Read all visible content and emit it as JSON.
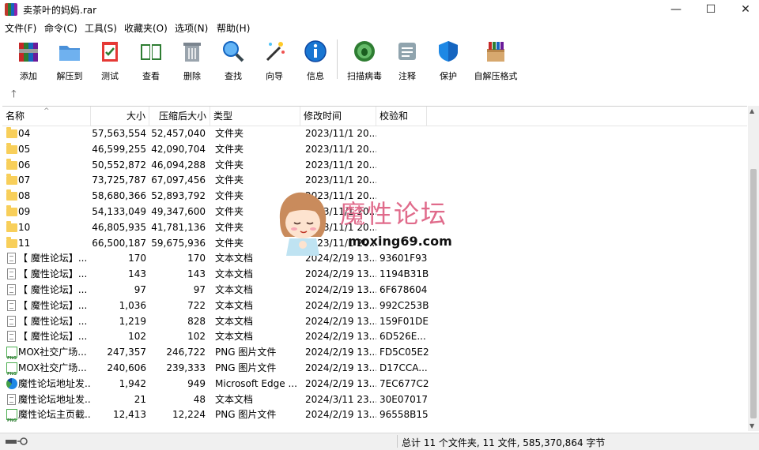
{
  "window": {
    "title": "卖茶叶的妈妈.rar",
    "controls": [
      "—",
      "☐",
      "✕"
    ]
  },
  "menu": [
    "文件(F)",
    "命令(C)",
    "工具(S)",
    "收藏夹(O)",
    "选项(N)",
    "帮助(H)"
  ],
  "toolbar": [
    {
      "label": "添加",
      "icon": "archive-books-icon"
    },
    {
      "label": "解压到",
      "icon": "folder-extract-icon"
    },
    {
      "label": "测试",
      "icon": "clipboard-check-icon"
    },
    {
      "label": "查看",
      "icon": "open-book-icon"
    },
    {
      "label": "删除",
      "icon": "trash-can-icon"
    },
    {
      "label": "查找",
      "icon": "magnifier-icon"
    },
    {
      "label": "向导",
      "icon": "magic-wand-icon"
    },
    {
      "label": "信息",
      "icon": "info-icon"
    },
    {
      "label": "扫描病毒",
      "icon": "bug-scan-icon"
    },
    {
      "label": "注释",
      "icon": "comment-icon"
    },
    {
      "label": "保护",
      "icon": "shield-icon"
    },
    {
      "label": "自解压格式",
      "icon": "sfx-box-icon"
    }
  ],
  "columns": [
    "名称",
    "大小",
    "压缩后大小",
    "类型",
    "修改时间",
    "校验和"
  ],
  "rows": [
    {
      "kind": "folder",
      "name": "04",
      "size": "57,563,554",
      "packed": "52,457,040",
      "type": "文件夹",
      "modified": "2023/11/1 20...",
      "crc": ""
    },
    {
      "kind": "folder",
      "name": "05",
      "size": "46,599,255",
      "packed": "42,090,704",
      "type": "文件夹",
      "modified": "2023/11/1 20...",
      "crc": ""
    },
    {
      "kind": "folder",
      "name": "06",
      "size": "50,552,872",
      "packed": "46,094,288",
      "type": "文件夹",
      "modified": "2023/11/1 20...",
      "crc": ""
    },
    {
      "kind": "folder",
      "name": "07",
      "size": "73,725,787",
      "packed": "67,097,456",
      "type": "文件夹",
      "modified": "2023/11/1 20...",
      "crc": ""
    },
    {
      "kind": "folder",
      "name": "08",
      "size": "58,680,366",
      "packed": "52,893,792",
      "type": "文件夹",
      "modified": "2023/11/1 20...",
      "crc": ""
    },
    {
      "kind": "folder",
      "name": "09",
      "size": "54,133,049",
      "packed": "49,347,600",
      "type": "文件夹",
      "modified": "2023/11/1 20...",
      "crc": ""
    },
    {
      "kind": "folder",
      "name": "10",
      "size": "46,805,935",
      "packed": "41,781,136",
      "type": "文件夹",
      "modified": "2023/11/1 20...",
      "crc": ""
    },
    {
      "kind": "folder",
      "name": "11",
      "size": "66,500,187",
      "packed": "59,675,936",
      "type": "文件夹",
      "modified": "2023/11/1 20...",
      "crc": ""
    },
    {
      "kind": "text",
      "name": "【 魔性论坛】...",
      "size": "170",
      "packed": "170",
      "type": "文本文档",
      "modified": "2024/2/19 13...",
      "crc": "93601F93"
    },
    {
      "kind": "text",
      "name": "【 魔性论坛】...",
      "size": "143",
      "packed": "143",
      "type": "文本文档",
      "modified": "2024/2/19 13...",
      "crc": "1194B31B"
    },
    {
      "kind": "text",
      "name": "【 魔性论坛】...",
      "size": "97",
      "packed": "97",
      "type": "文本文档",
      "modified": "2024/2/19 13...",
      "crc": "6F678604"
    },
    {
      "kind": "text",
      "name": "【 魔性论坛】...",
      "size": "1,036",
      "packed": "722",
      "type": "文本文档",
      "modified": "2024/2/19 13...",
      "crc": "992C253B"
    },
    {
      "kind": "text",
      "name": "【 魔性论坛】...",
      "size": "1,219",
      "packed": "828",
      "type": "文本文档",
      "modified": "2024/2/19 13...",
      "crc": "159F01DE"
    },
    {
      "kind": "text",
      "name": "【 魔性论坛】...",
      "size": "102",
      "packed": "102",
      "type": "文本文档",
      "modified": "2024/2/19 13...",
      "crc": "6D526E..."
    },
    {
      "kind": "png",
      "name": "MOX社交广场...",
      "size": "247,357",
      "packed": "246,722",
      "type": "PNG 图片文件",
      "modified": "2024/2/19 13...",
      "crc": "FD5C05E2"
    },
    {
      "kind": "png",
      "name": "MOX社交广场...",
      "size": "240,606",
      "packed": "239,333",
      "type": "PNG 图片文件",
      "modified": "2024/2/19 13...",
      "crc": "D17CCA..."
    },
    {
      "kind": "edge",
      "name": "魔性论坛地址发...",
      "size": "1,942",
      "packed": "949",
      "type": "Microsoft Edge ...",
      "modified": "2024/2/19 13...",
      "crc": "7EC677C2"
    },
    {
      "kind": "text",
      "name": "魔性论坛地址发...",
      "size": "21",
      "packed": "48",
      "type": "文本文档",
      "modified": "2024/3/11 23...",
      "crc": "30E07017"
    },
    {
      "kind": "png",
      "name": "魔性论坛主页截...",
      "size": "12,413",
      "packed": "12,224",
      "type": "PNG 图片文件",
      "modified": "2024/2/19 13...",
      "crc": "96558B15"
    }
  ],
  "status": {
    "summary": "总计 11 个文件夹, 11 文件, 585,370,864 字节"
  },
  "watermark": {
    "title": "魔性论坛",
    "url": "moxing69.com"
  },
  "colors": {
    "folder": "#f8cf5a",
    "watermark_pink": "#e06b8b",
    "scan_green": "#2e7d32"
  }
}
